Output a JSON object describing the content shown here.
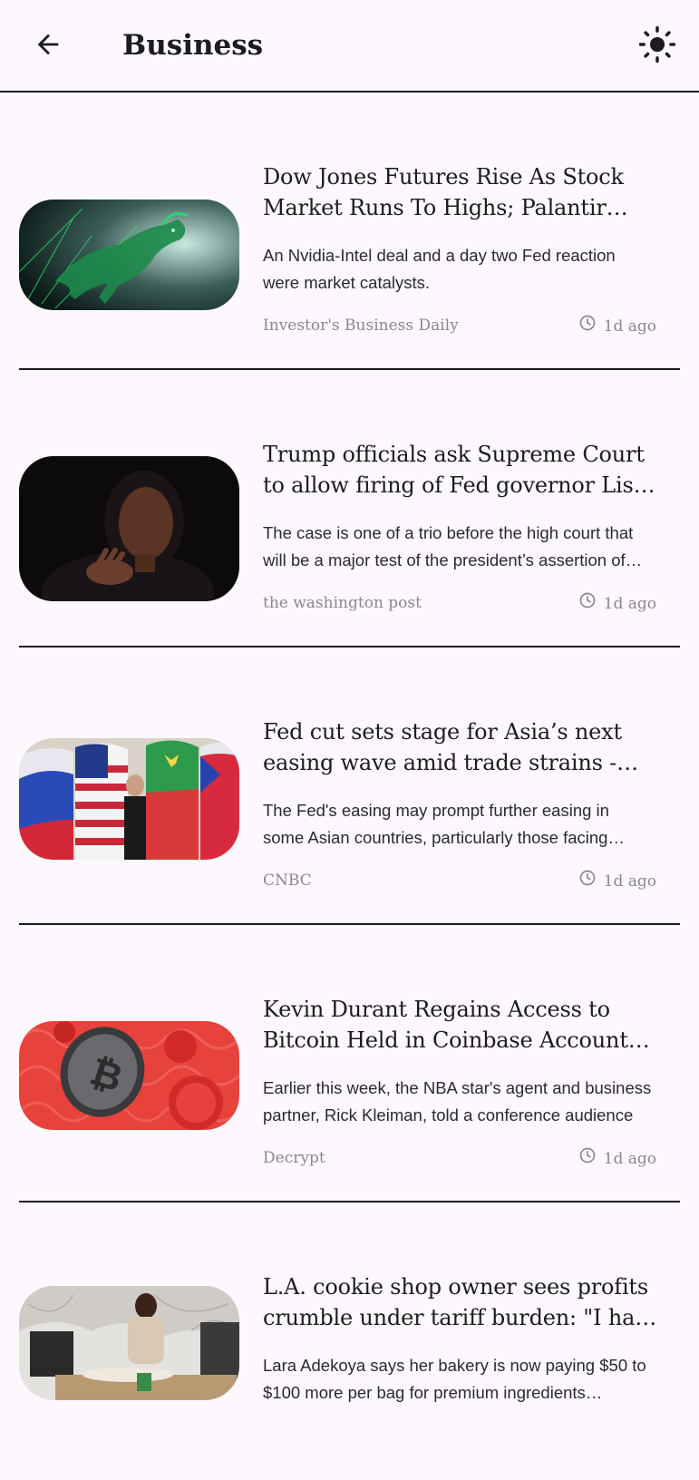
{
  "header": {
    "title": "Business",
    "back_icon": "arrow-left-icon",
    "theme_icon": "sun-icon"
  },
  "articles": [
    {
      "title": "Dow Jones Futures Rise As Stock Market Runs To Highs; Palantir Leads",
      "description": "An Nvidia-Intel deal and a day two Fed reaction were market catalysts.",
      "source": "Investor's Business Daily",
      "time": "1d ago",
      "image": "green-bull-illustration"
    },
    {
      "title": "Trump officials ask Supreme Court to allow firing of Fed governor Lisa Cook",
      "description": "The case is one of a trio before the high court that will be a major test of the president’s assertion of power",
      "source": "the washington post",
      "time": "1d ago",
      "image": "woman-speaking-photo"
    },
    {
      "title": "Fed cut sets stage for Asia’s next easing wave amid trade strains - CNBC",
      "description": "The Fed's easing may prompt further easing in some Asian countries, particularly those facing growing trade pressures",
      "source": "CNBC",
      "time": "1d ago",
      "image": "flags-photo"
    },
    {
      "title": "Kevin Durant Regains Access to Bitcoin Held in Coinbase Account After Years",
      "description": "Earlier this week, the NBA star's agent and business partner, Rick Kleiman, told a conference audience",
      "source": "Decrypt",
      "time": "1d ago",
      "image": "bitcoin-coins-illustration"
    },
    {
      "title": "L.A. cookie shop owner sees profits crumble under tariff burden: \"I have to pay more\"",
      "description": "Lara Adekoya says her bakery is now paying $50 to $100 more per bag for premium ingredients imported from abroad",
      "source": "",
      "time": "",
      "image": "bakery-photo"
    }
  ],
  "colors": {
    "background": "#fdf8fd",
    "text": "#1d1b20",
    "muted": "#8a8690"
  }
}
